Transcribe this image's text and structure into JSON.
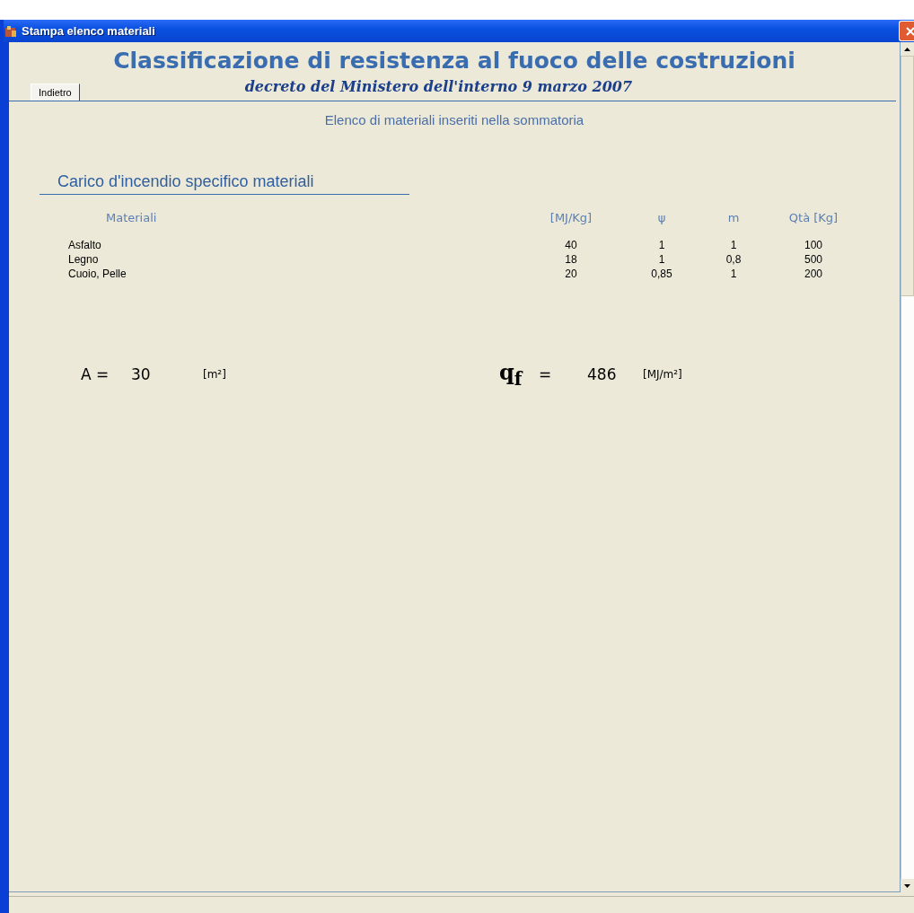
{
  "window": {
    "title": "Stampa elenco materiali"
  },
  "heading": {
    "title": "Classificazione di resistenza al fuoco delle costruzioni",
    "subtitle": "decreto del  Ministero dell'interno 9 marzo 2007"
  },
  "back_button": {
    "label": "Indietro"
  },
  "list_caption": "Elenco di materiali inseriti nella sommatoria",
  "section_title": "Carico d'incendio specifico materiali",
  "table": {
    "columns": [
      "Materiali",
      "[MJ/Kg]",
      "ψ",
      "m",
      "Qtà [Kg]"
    ],
    "rows": [
      [
        "Asfalto",
        "40",
        "1",
        "1",
        "100"
      ],
      [
        "Legno",
        "18",
        "1",
        "0,8",
        "500"
      ],
      [
        "Cuoio, Pelle",
        "20",
        "0,85",
        "1",
        "200"
      ]
    ]
  },
  "area": {
    "label": "A =",
    "value": "30",
    "unit": "[m²]"
  },
  "load": {
    "label": "q$_{f}$",
    "equals": "=",
    "value": "486",
    "unit": "[MJ/m²]"
  }
}
